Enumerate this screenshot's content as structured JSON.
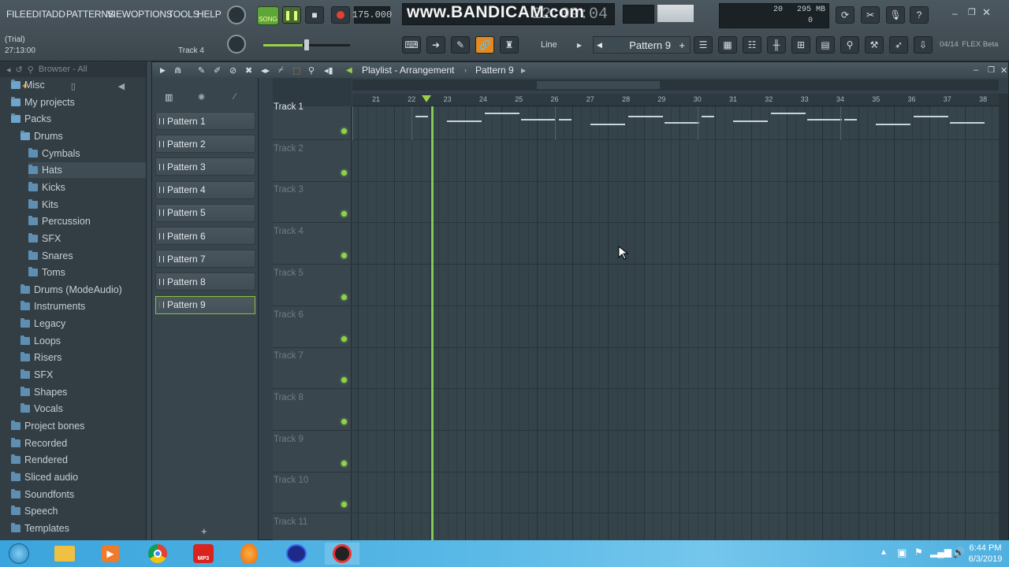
{
  "menu": [
    "FILE",
    "EDIT",
    "ADD",
    "PATTERNS",
    "VIEW",
    "OPTIONS",
    "TOOLS",
    "HELP"
  ],
  "transport": {
    "mode": "SONG",
    "tempo": "175.000",
    "time": "22:09:04"
  },
  "watermark": "www.BANDICAM.com",
  "status": {
    "trial": "(Trial)",
    "time": "27:13:00",
    "track": "Track 4"
  },
  "cpu": {
    "value": "20",
    "memory": "295 MB",
    "polyphony": "0"
  },
  "snap_mode": "Line",
  "current_pattern": "Pattern 9",
  "plugin_info": {
    "count": "04/14",
    "name": "FLEX Beta"
  },
  "browser": {
    "title": "Browser - All",
    "items": [
      {
        "label": "Misc",
        "indent": 1
      },
      {
        "label": "My projects",
        "indent": 1
      },
      {
        "label": "Packs",
        "indent": 1
      },
      {
        "label": "Drums",
        "indent": 2
      },
      {
        "label": "Cymbals",
        "indent": 3
      },
      {
        "label": "Hats",
        "indent": 3
      },
      {
        "label": "Kicks",
        "indent": 3
      },
      {
        "label": "Kits",
        "indent": 3
      },
      {
        "label": "Percussion",
        "indent": 3
      },
      {
        "label": "SFX",
        "indent": 3
      },
      {
        "label": "Snares",
        "indent": 3
      },
      {
        "label": "Toms",
        "indent": 3
      },
      {
        "label": "Drums (ModeAudio)",
        "indent": 2
      },
      {
        "label": "Instruments",
        "indent": 2
      },
      {
        "label": "Legacy",
        "indent": 2
      },
      {
        "label": "Loops",
        "indent": 2
      },
      {
        "label": "Risers",
        "indent": 2
      },
      {
        "label": "SFX",
        "indent": 2
      },
      {
        "label": "Shapes",
        "indent": 2
      },
      {
        "label": "Vocals",
        "indent": 2
      },
      {
        "label": "Project bones",
        "indent": 1
      },
      {
        "label": "Recorded",
        "indent": 1
      },
      {
        "label": "Rendered",
        "indent": 1
      },
      {
        "label": "Sliced audio",
        "indent": 1
      },
      {
        "label": "Soundfonts",
        "indent": 1
      },
      {
        "label": "Speech",
        "indent": 1
      },
      {
        "label": "Templates",
        "indent": 1
      }
    ]
  },
  "playlist": {
    "title": "Playlist - Arrangement",
    "pattern": "Pattern 9",
    "patterns": [
      "Pattern 1",
      "Pattern 2",
      "Pattern 3",
      "Pattern 4",
      "Pattern 5",
      "Pattern 6",
      "Pattern 7",
      "Pattern 8",
      "Pattern 9"
    ],
    "tracks": [
      "Track 1",
      "Track 2",
      "Track 3",
      "Track 4",
      "Track 5",
      "Track 6",
      "Track 7",
      "Track 8",
      "Track 9",
      "Track 10",
      "Track 11"
    ],
    "bars": [
      "21",
      "22",
      "23",
      "24",
      "25",
      "26",
      "27",
      "28",
      "29",
      "30",
      "31",
      "32",
      "33",
      "34",
      "35",
      "36",
      "37",
      "38"
    ],
    "clips": [
      {
        "name": "Pattern 5",
        "bar": 22
      },
      {
        "name": "Pattern 5",
        "bar": 26
      },
      {
        "name": "Pattern 6",
        "bar": 30
      },
      {
        "name": "Pattern 6",
        "bar": 34
      }
    ]
  },
  "clock": {
    "time": "6:44 PM",
    "date": "6/3/2019"
  },
  "taskbar": {
    "mp3_label": "MP3"
  }
}
